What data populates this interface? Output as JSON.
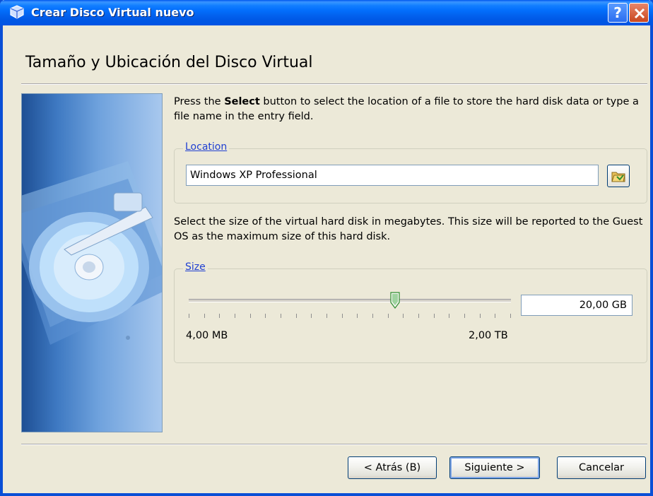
{
  "window": {
    "title": "Crear Disco Virtual nuevo",
    "help_label": "?"
  },
  "page": {
    "title": "Tamaño y Ubicación del Disco Virtual",
    "intro_prefix": "Press the ",
    "intro_bold": "Select",
    "intro_suffix": " button to select the location of a file to store the hard disk data or type a file name in the entry field."
  },
  "location": {
    "legend": "Location",
    "value": "Windows XP Professional"
  },
  "size": {
    "description": "Select the size of the virtual hard disk in megabytes. This size will be reported to the Guest OS as the maximum size of this hard disk.",
    "legend": "Size",
    "value": "20,00 GB",
    "min_label": "4,00 MB",
    "max_label": "2,00 TB",
    "slider_fraction": 0.64
  },
  "buttons": {
    "back": "< Atrás (B)",
    "next": "Siguiente >",
    "cancel": "Cancelar"
  },
  "colors": {
    "titlebar": "#0054e3",
    "accent_label": "#1f3fd2",
    "dialog_bg": "#ece9d8"
  }
}
